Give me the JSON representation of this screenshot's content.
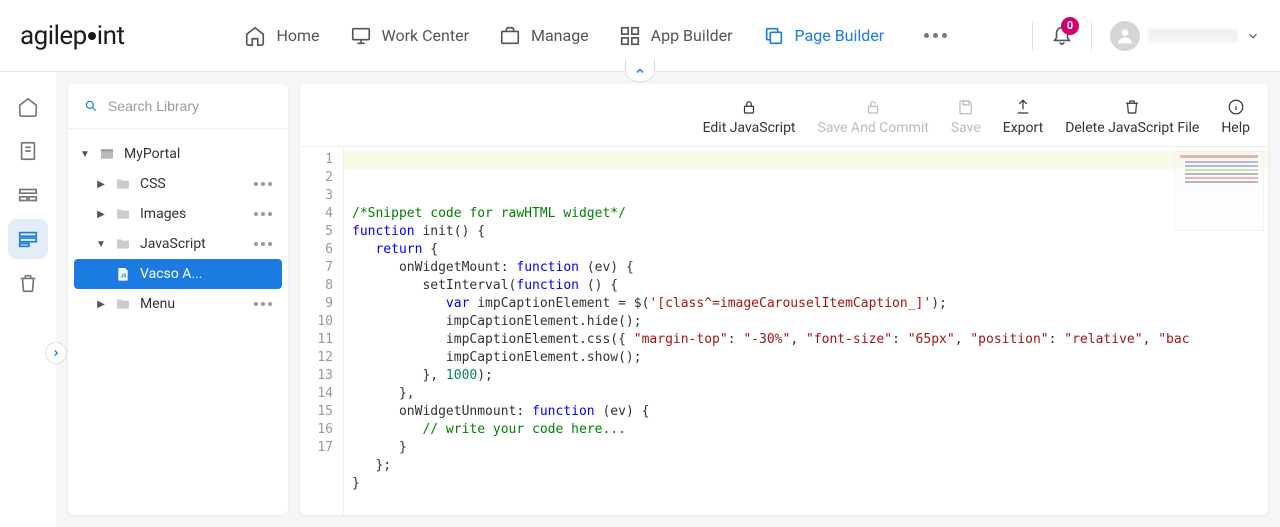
{
  "header": {
    "logo_text": "agilepoint",
    "nav": [
      {
        "id": "home",
        "label": "Home"
      },
      {
        "id": "work-center",
        "label": "Work Center"
      },
      {
        "id": "manage",
        "label": "Manage"
      },
      {
        "id": "app-builder",
        "label": "App Builder"
      },
      {
        "id": "page-builder",
        "label": "Page Builder",
        "active": true
      }
    ],
    "notifications": "0"
  },
  "search": {
    "placeholder": "Search Library"
  },
  "tree": {
    "root": "MyPortal",
    "css": "CSS",
    "images": "Images",
    "javascript": "JavaScript",
    "selected_file": "Vacso A...",
    "menu": "Menu"
  },
  "toolbar": {
    "edit": "Edit JavaScript",
    "save_commit": "Save And Commit",
    "save": "Save",
    "export": "Export",
    "delete": "Delete JavaScript File",
    "help": "Help"
  },
  "code": {
    "lines": [
      {
        "n": 1,
        "html": "<span class='c-comment'>/*Snippet code for rawHTML widget*/</span>"
      },
      {
        "n": 2,
        "html": "<span class='c-keyword'>function</span> init() {"
      },
      {
        "n": 3,
        "html": "   <span class='c-keyword'>return</span> {"
      },
      {
        "n": 4,
        "html": "      onWidgetMount: <span class='c-keyword'>function</span> (ev) {"
      },
      {
        "n": 5,
        "html": "         setInterval(<span class='c-keyword'>function</span> () {"
      },
      {
        "n": 6,
        "html": "            <span class='c-keyword'>var</span> impCaptionElement = $(<span class='c-string'>'[class^=imageCarouselItemCaption_]'</span>);"
      },
      {
        "n": 7,
        "html": "            impCaptionElement.hide();"
      },
      {
        "n": 8,
        "html": "            impCaptionElement.css({ <span class='c-string'>\"margin-top\"</span>: <span class='c-string'>\"-30%\"</span>, <span class='c-string'>\"font-size\"</span>: <span class='c-string'>\"65px\"</span>, <span class='c-string'>\"position\"</span>: <span class='c-string'>\"relative\"</span>, <span class='c-string'>\"bac</span>"
      },
      {
        "n": 9,
        "html": "            impCaptionElement.show();"
      },
      {
        "n": 10,
        "html": "         }, <span class='c-num'>1000</span>);"
      },
      {
        "n": 11,
        "html": "      },"
      },
      {
        "n": 12,
        "html": "      onWidgetUnmount: <span class='c-keyword'>function</span> (ev) {"
      },
      {
        "n": 13,
        "html": "         <span class='c-comment'>// write your code here...</span>"
      },
      {
        "n": 14,
        "html": "      }"
      },
      {
        "n": 15,
        "html": "   };"
      },
      {
        "n": 16,
        "html": "}"
      },
      {
        "n": 17,
        "html": ""
      }
    ]
  }
}
